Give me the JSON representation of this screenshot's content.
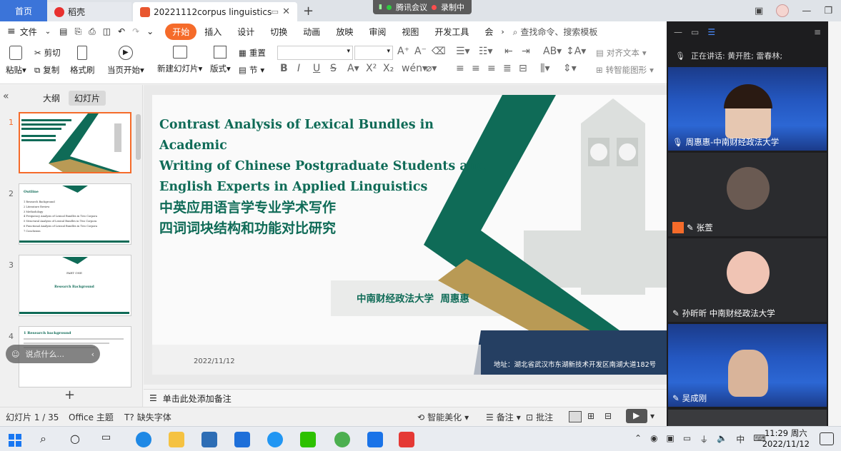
{
  "tabs": {
    "home": "首页",
    "docer": "稻壳",
    "document": "20221112corpus linguistics"
  },
  "meeting_bar": {
    "app": "腾讯会议",
    "status": "录制中"
  },
  "menu": {
    "file": "文件",
    "items": [
      "开始",
      "插入",
      "设计",
      "切换",
      "动画",
      "放映",
      "审阅",
      "视图",
      "开发工具",
      "会"
    ],
    "search": "查找命令、搜索模板"
  },
  "ribbon": {
    "paste": "粘贴",
    "cut": "剪切",
    "copy": "复制",
    "format_painter": "格式刷",
    "start_from_current": "当页开始",
    "new_slide": "新建幻灯片",
    "layout": "版式",
    "section": "节",
    "reset": "重置",
    "align_text": "对齐文本",
    "smart_graphic": "转智能图形"
  },
  "left_panel": {
    "tab_outline": "大纲",
    "tab_slides": "幻灯片",
    "say_something": "说点什么...",
    "thumbs": [
      {
        "num": "1"
      },
      {
        "num": "2",
        "title": "Outline",
        "lines": [
          "1 Research Background",
          "2 Literature Review",
          "3 Methodology",
          "4 Frequency Analysis of Lexical Bundles in Two Corpora",
          "5 Structural Analysis of Lexical Bundles in Two Corpora",
          "6 Functional Analysis of Lexical Bundles in Two Corpora",
          "7 Conclusion"
        ]
      },
      {
        "num": "3",
        "part": "PART ONE",
        "title": "Research Background"
      },
      {
        "num": "4",
        "title": "1 Research background"
      }
    ]
  },
  "slide": {
    "title_en_lines": [
      "Contrast Analysis of Lexical Bundles in Academic",
      "Writing of Chinese Postgraduate Students and",
      "English Experts in Applied Linguistics"
    ],
    "title_cn_lines": [
      "中英应用语言学专业学术写作",
      "四词词块结构和功能对比研究"
    ],
    "author": "中南财经政法大学  周惠惠",
    "date": "2022/11/12",
    "address": "地址：湖北省武汉市东湖新技术开发区南湖大道182号"
  },
  "notes_placeholder": "单击此处添加备注",
  "status": {
    "slide_counter": "幻灯片 1 / 35",
    "theme": "Office 主题",
    "missing_font": "缺失字体",
    "smart_beautify": "智能美化",
    "notes": "备注",
    "comments": "批注"
  },
  "meeting": {
    "speaking": "正在讲话: 黄开胜; 雷春林;",
    "participants": [
      {
        "name": "周惠惠-中南财经政法大学"
      },
      {
        "name": "张萱"
      },
      {
        "name": "孙昕昕  中南财经政法大学"
      },
      {
        "name": "吴成刚"
      }
    ]
  },
  "clock": {
    "time": "11:29 周六",
    "date": "2022/11/12"
  },
  "colors": {
    "accent": "#f56b2a",
    "slide_green": "#0f6b57",
    "slide_gold": "#b99a55",
    "slide_navy": "#253f62"
  }
}
